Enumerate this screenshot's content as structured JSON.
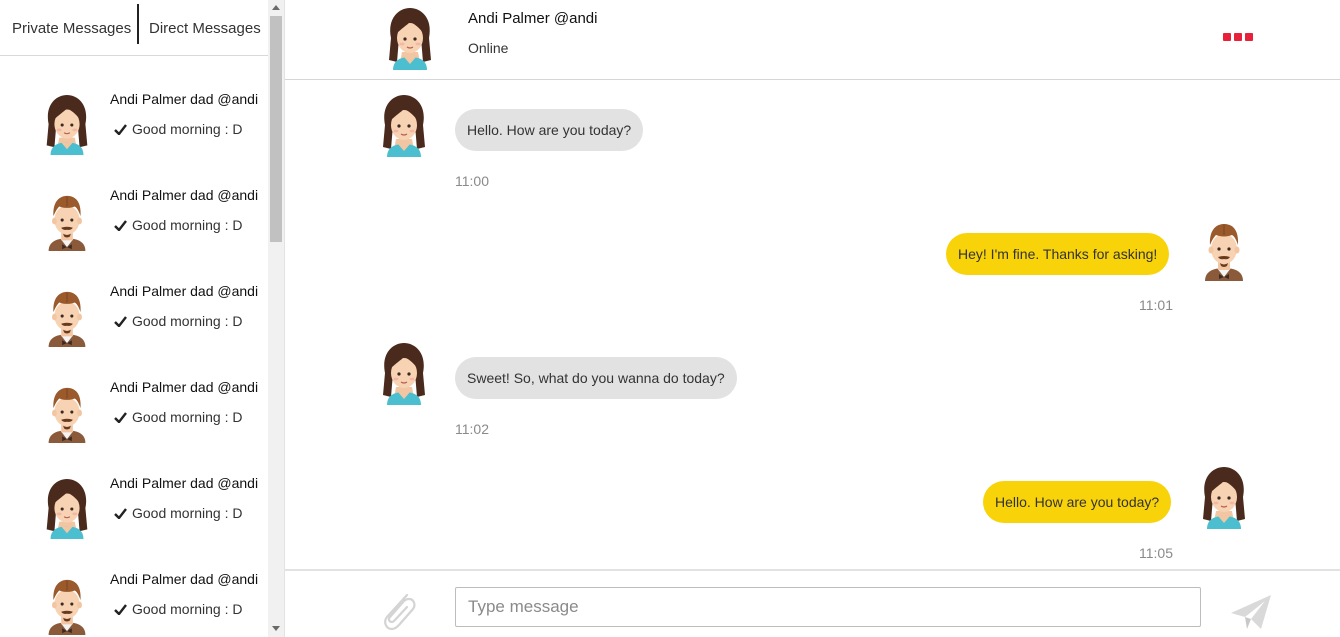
{
  "sidebar": {
    "tabs": [
      {
        "label": "Private Messages"
      },
      {
        "label": "Direct Messages"
      }
    ],
    "conversations": [
      {
        "name": "Andi Palmer dad @andi",
        "preview": "Good morning : D",
        "avatar": "female-avatar"
      },
      {
        "name": "Andi Palmer dad @andi",
        "preview": "Good morning : D",
        "avatar": "male-avatar"
      },
      {
        "name": "Andi Palmer dad @andi",
        "preview": "Good morning : D",
        "avatar": "male-avatar"
      },
      {
        "name": "Andi Palmer dad @andi",
        "preview": "Good morning : D",
        "avatar": "male-avatar"
      },
      {
        "name": "Andi Palmer dad @andi",
        "preview": "Good morning : D",
        "avatar": "female-avatar"
      },
      {
        "name": "Andi Palmer dad @andi",
        "preview": "Good morning : D",
        "avatar": "male-avatar"
      }
    ]
  },
  "header": {
    "name": "Andi Palmer @andi",
    "status": "Online",
    "menu_icon": "more-dots-icon",
    "menu_color": "#e8203a"
  },
  "messages": [
    {
      "direction": "incoming",
      "text": "Hello. How are you today?",
      "time": "11:00",
      "avatar": "female-avatar"
    },
    {
      "direction": "outgoing",
      "text": "Hey! I'm fine. Thanks for asking!",
      "time": "11:01",
      "avatar": "male-avatar"
    },
    {
      "direction": "incoming",
      "text": "Sweet! So, what do you wanna do today?",
      "time": "11:02",
      "avatar": "female-avatar"
    },
    {
      "direction": "outgoing",
      "text": "Hello. How are you today?",
      "time": "11:05",
      "avatar": "female-avatar"
    }
  ],
  "composer": {
    "placeholder": "Type message",
    "attach_icon": "paperclip-icon",
    "send_icon": "paper-plane-icon"
  },
  "colors": {
    "incoming_bubble": "#e2e2e2",
    "outgoing_bubble": "#f9d30a",
    "accent": "#e8203a"
  }
}
